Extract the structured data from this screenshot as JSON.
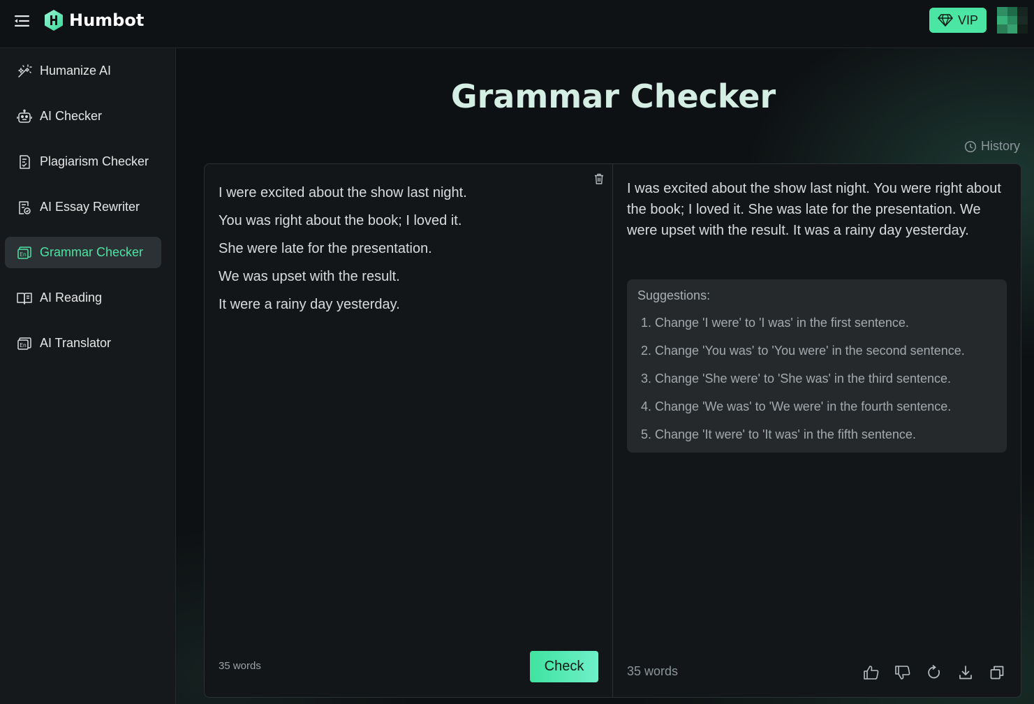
{
  "header": {
    "brand": "Humbot",
    "vip_label": "VIP",
    "menu_icon": "hamburger-menu-icon",
    "vip_icon": "diamond-icon",
    "brand_color": "#4be6a3"
  },
  "sidebar": {
    "items": [
      {
        "label": "Humanize AI",
        "icon": "magic-wand-icon",
        "active": false
      },
      {
        "label": "AI Checker",
        "icon": "robot-icon",
        "active": false
      },
      {
        "label": "Plagiarism Checker",
        "icon": "document-check-icon",
        "active": false
      },
      {
        "label": "AI Essay Rewriter",
        "icon": "essay-edit-icon",
        "active": false
      },
      {
        "label": "Grammar Checker",
        "icon": "grammar-en-icon",
        "active": true
      },
      {
        "label": "AI Reading",
        "icon": "book-icon",
        "active": false
      },
      {
        "label": "AI Translator",
        "icon": "translate-icon",
        "active": false
      }
    ]
  },
  "main": {
    "title": "Grammar Checker",
    "history_label": "History",
    "input": {
      "lines": [
        "I were excited about the show last night.",
        "You was right about the book; I loved it.",
        "She were late for the presentation.",
        "We was upset with the result.",
        "It were a rainy day yesterday."
      ],
      "word_count": "35 words",
      "check_label": "Check"
    },
    "output": {
      "text": "I was excited about the show last night. You were right about the book; I loved it. She was late for the presentation. We were upset with the result. It was a rainy day yesterday.",
      "suggestions_title": "Suggestions:",
      "suggestions": [
        "Change 'I were' to 'I was' in the first sentence.",
        "Change 'You was' to 'You were' in the second sentence.",
        "Change 'She were' to 'She was' in the third sentence.",
        "Change 'We was' to 'We were' in the fourth sentence.",
        "Change 'It were' to 'It was' in the fifth sentence."
      ],
      "word_count": "35 words",
      "actions": [
        "thumbs-up-icon",
        "thumbs-down-icon",
        "refresh-icon",
        "download-icon",
        "copy-icon"
      ]
    }
  }
}
